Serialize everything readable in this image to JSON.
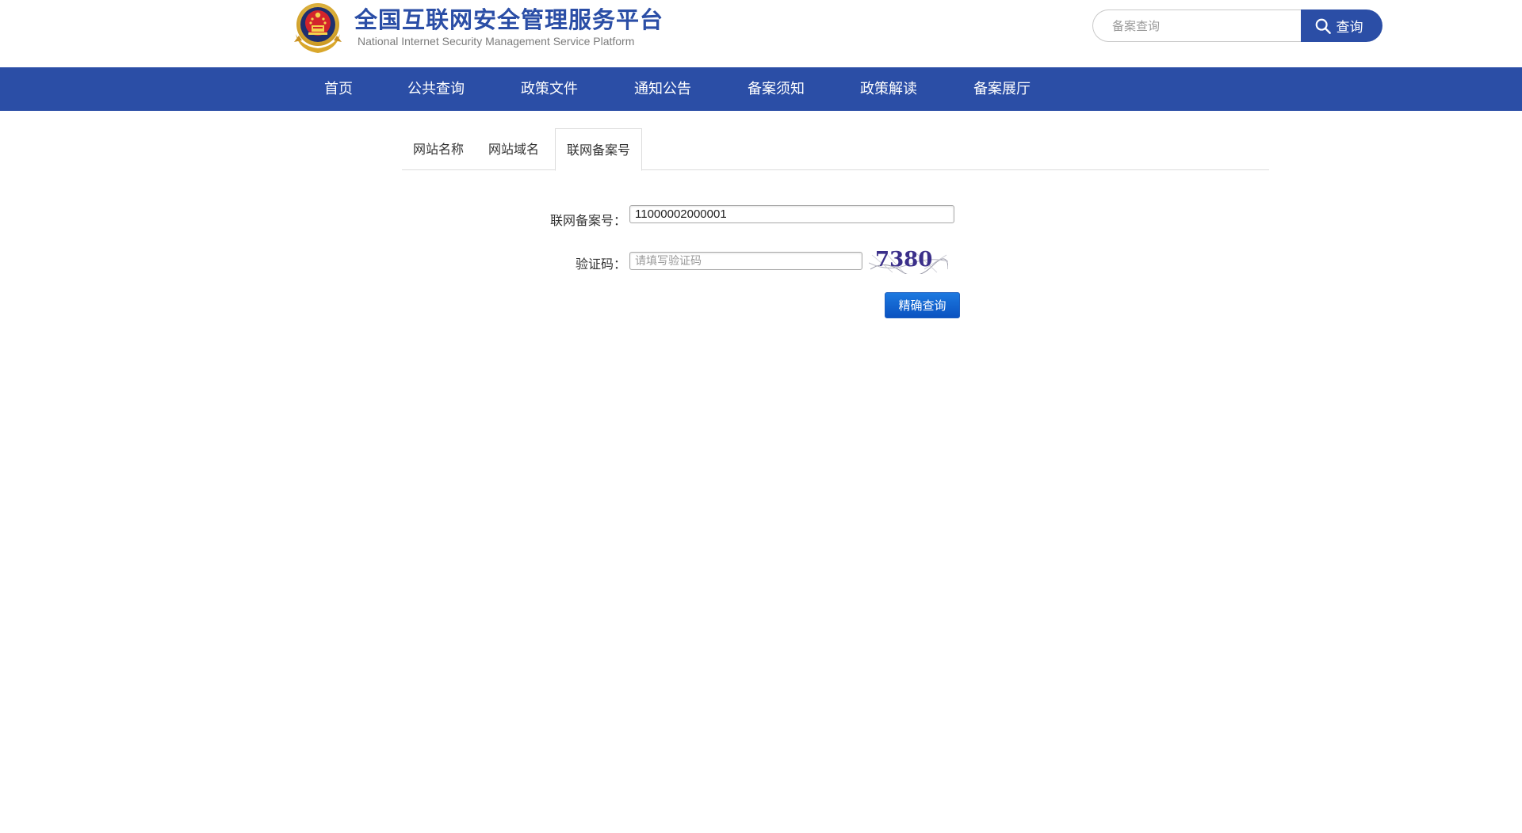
{
  "header": {
    "title_cn": "全国互联网安全管理服务平台",
    "title_en": "National Internet Security Management Service Platform",
    "search_placeholder": "备案查询",
    "search_button": "查询"
  },
  "nav": {
    "items": [
      "首页",
      "公共查询",
      "政策文件",
      "通知公告",
      "备案须知",
      "政策解读",
      "备案展厅"
    ]
  },
  "tabs": {
    "items": [
      "网站名称",
      "网站域名",
      "联网备案号"
    ],
    "active": 2
  },
  "form": {
    "record_label": "联网备案号：",
    "record_value": "11000002000001",
    "captcha_label": "验证码：",
    "captcha_placeholder": "请填写验证码",
    "captcha_text": "7380",
    "submit_label": "精确查询"
  },
  "colors": {
    "brand_blue": "#2b4ea6",
    "button_blue": "#0a52c0"
  },
  "icons": {
    "logo": "police-emblem-icon",
    "search": "search-icon"
  }
}
